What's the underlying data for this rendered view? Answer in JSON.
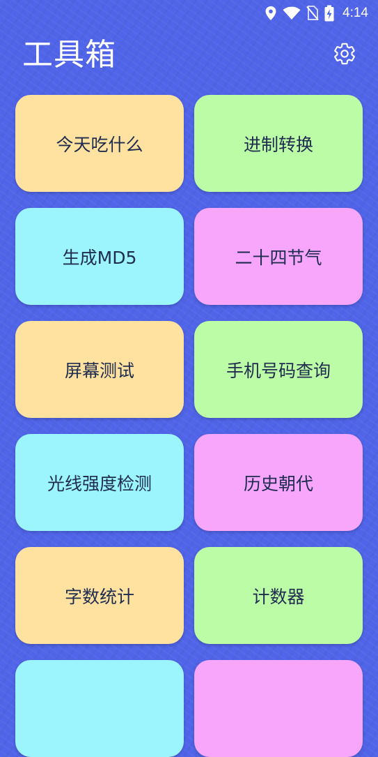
{
  "status_bar": {
    "time": "4:14",
    "icons": [
      "location-icon",
      "wifi-icon",
      "no-sim-icon",
      "battery-charging-icon"
    ],
    "icon_color": "#ffffff"
  },
  "header": {
    "title": "工具箱",
    "settings_icon": "gear-icon"
  },
  "tools": [
    {
      "label": "今天吃什么",
      "color": "#ffe2a0"
    },
    {
      "label": "进制转换",
      "color": "#bdfca6"
    },
    {
      "label": "生成MD5",
      "color": "#9cf5fd"
    },
    {
      "label": "二十四节气",
      "color": "#f7a6fb"
    },
    {
      "label": "屏幕测试",
      "color": "#ffe2a0"
    },
    {
      "label": "手机号码查询",
      "color": "#bdfca6"
    },
    {
      "label": "光线强度检测",
      "color": "#9cf5fd"
    },
    {
      "label": "历史朝代",
      "color": "#f7a6fb"
    },
    {
      "label": "字数统计",
      "color": "#ffe2a0"
    },
    {
      "label": "计数器",
      "color": "#bdfca6"
    },
    {
      "label": "",
      "color": "#9cf5fd"
    },
    {
      "label": "",
      "color": "#f7a6fb"
    }
  ],
  "theme": {
    "background": "#4f64e8",
    "tile_text": "#1f2c50"
  }
}
